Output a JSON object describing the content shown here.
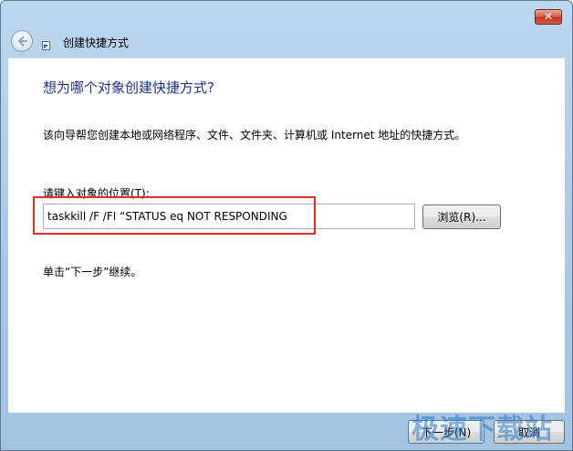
{
  "window": {
    "title": "创建快捷方式",
    "close_label": "✕"
  },
  "wizard": {
    "heading": "想为哪个对象创建快捷方式?",
    "description": "该向导帮您创建本地或网络程序、文件、文件夹、计算机或 Internet 地址的快捷方式。",
    "field_label": "请键入对象的位置(T):",
    "location_value": "taskkill /F /FI “STATUS eq NOT RESPONDING",
    "browse_label": "浏览(R)...",
    "next_instruction": "单击“下一步”继续。"
  },
  "footer": {
    "next_label": "下一步(N)",
    "cancel_label": "取消"
  },
  "watermark": "极速下载站",
  "icons": {
    "back": "back-arrow-icon",
    "shortcut": "shortcut-arrow-icon",
    "close": "close-icon"
  },
  "colors": {
    "heading": "#1e3287",
    "highlight": "#d9302a",
    "close_button": "#c23a20",
    "titlebar": "#bcd6ee"
  }
}
